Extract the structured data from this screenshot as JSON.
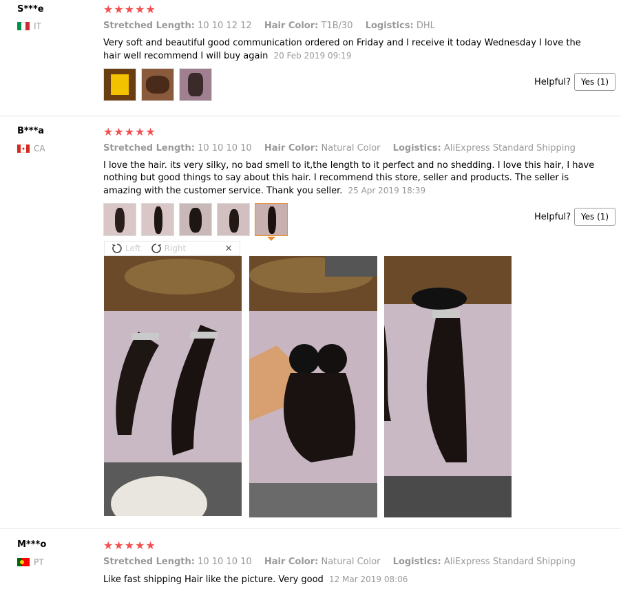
{
  "reviews": [
    {
      "user": "S***e",
      "country": "IT",
      "flag_colors": [
        "#009246",
        "#ffffff",
        "#ce2b37"
      ],
      "stars": "★★★★★",
      "meta": [
        {
          "label": "Stretched Length:",
          "value": "10 10 12 12"
        },
        {
          "label": "Hair Color:",
          "value": "T1B/30"
        },
        {
          "label": "Logistics:",
          "value": "DHL"
        }
      ],
      "text": "Very soft and beautiful good communication ordered on Friday and I receive it today Wednesday I love the hair well recommend I will buy again",
      "date": "20 Feb 2019 09:19",
      "helpful_label": "Helpful?",
      "yes_label": "Yes (1)"
    },
    {
      "user": "B***a",
      "country": "CA",
      "flag_colors": [
        "#d52b1e",
        "#ffffff",
        "#d52b1e"
      ],
      "stars": "★★★★★",
      "meta": [
        {
          "label": "Stretched Length:",
          "value": "10 10 10 10"
        },
        {
          "label": "Hair Color:",
          "value": "Natural Color"
        },
        {
          "label": "Logistics:",
          "value": "AliExpress Standard Shipping"
        }
      ],
      "text": "I love the hair. its very silky, no bad smell to it,the length to it perfect and no shedding. I love this hair, I have nothing but good things to say about this hair. I recommend this store, seller and products. The seller is amazing with the customer service. Thank you seller.",
      "date": "25 Apr 2019 18:39",
      "helpful_label": "Helpful?",
      "yes_label": "Yes (1)"
    },
    {
      "user": "M***o",
      "country": "PT",
      "flag_colors": [
        "#006600",
        "#ff0000",
        "#ff0000"
      ],
      "stars": "★★★★★",
      "meta": [
        {
          "label": "Stretched Length:",
          "value": "10 10 10 10"
        },
        {
          "label": "Hair Color:",
          "value": "Natural Color"
        },
        {
          "label": "Logistics:",
          "value": "AliExpress Standard Shipping"
        }
      ],
      "text": "Like fast shipping Hair like the picture. Very good",
      "date": "12 Mar 2019 08:06"
    }
  ],
  "viewer": {
    "left_label": "Left",
    "right_label": "Right",
    "close_label": "×"
  },
  "colors": {
    "star": "#f24f4f",
    "active_thumb": "#f08a24"
  }
}
